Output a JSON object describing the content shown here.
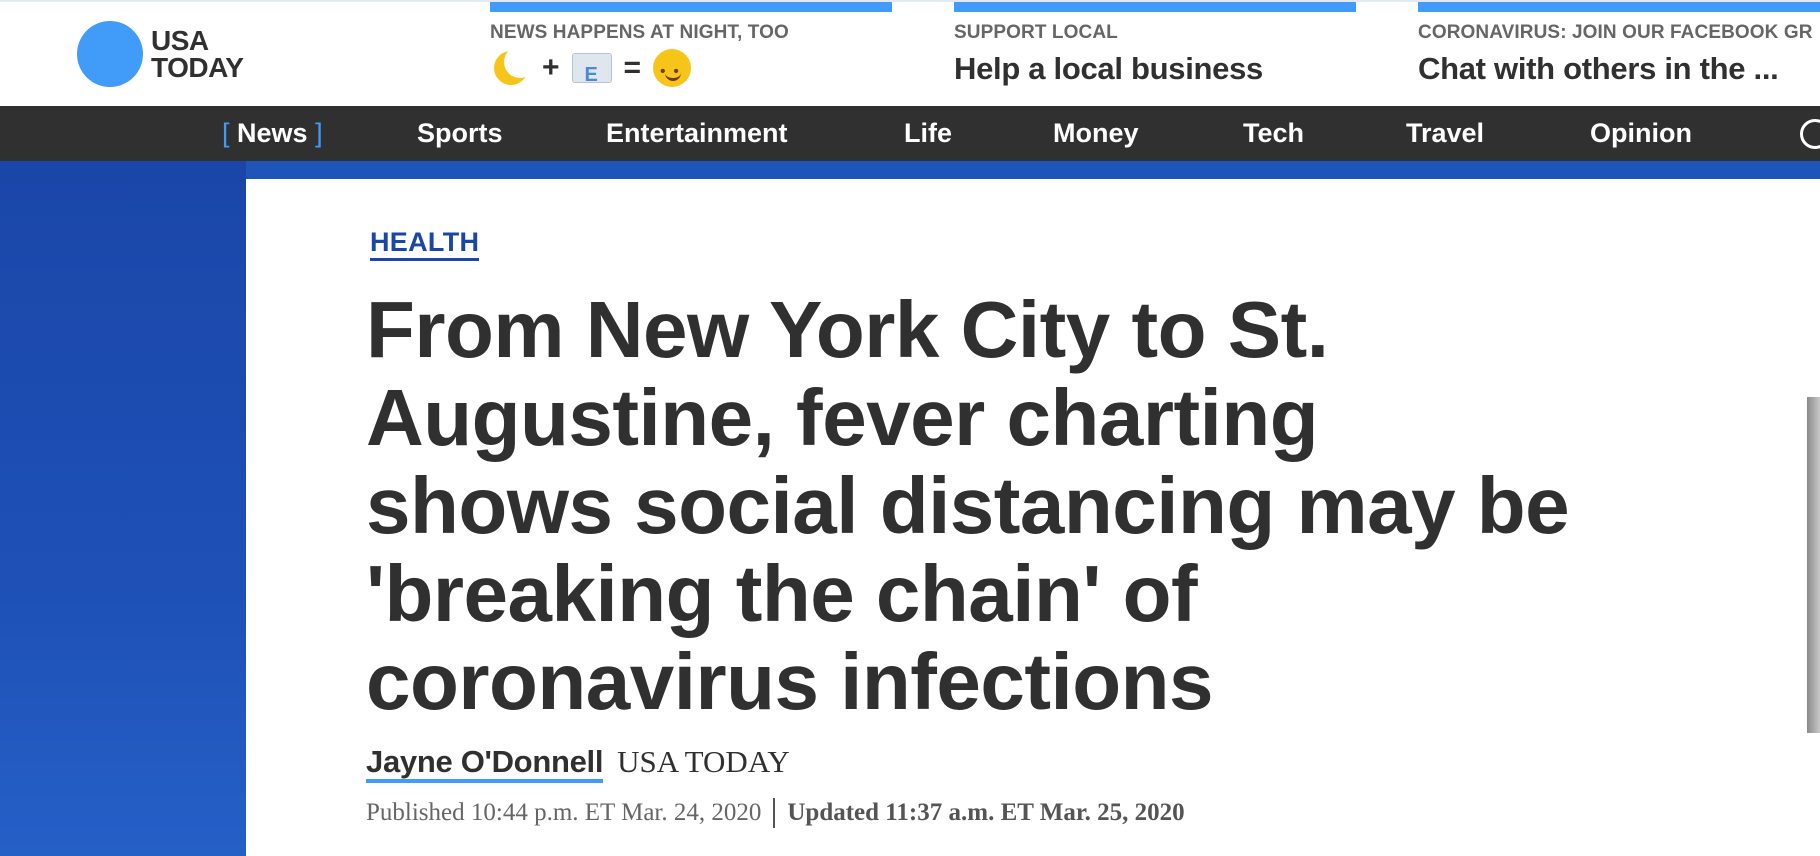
{
  "logo": {
    "line1": "USA",
    "line2": "TODAY"
  },
  "promos": [
    {
      "kicker": "NEWS HAPPENS AT NIGHT, TOO",
      "title": "",
      "emoji": [
        "moon-icon",
        "+",
        "envelope-icon",
        "=",
        "smirk-icon"
      ],
      "plus": "+",
      "equals": "="
    },
    {
      "kicker": "SUPPORT LOCAL",
      "title": "Help a local business"
    },
    {
      "kicker": "CORONAVIRUS: JOIN OUR FACEBOOK GR",
      "title": "Chat with others in the ..."
    }
  ],
  "nav": {
    "items": [
      "News",
      "Sports",
      "Entertainment",
      "Life",
      "Money",
      "Tech",
      "Travel",
      "Opinion"
    ],
    "active_open": "[",
    "active_close": "]"
  },
  "article": {
    "section": "HEALTH",
    "headline_lines": [
      "From New York City to St.",
      "Augustine, fever charting",
      "shows social distancing may be",
      "'breaking the chain' of",
      "coronavirus infections"
    ],
    "author": "Jayne O'Donnell",
    "outlet": "USA TODAY",
    "published": "Published 10:44 p.m. ET Mar. 24, 2020",
    "updated": "Updated 11:37 a.m. ET Mar. 25, 2020"
  },
  "colors": {
    "brand_blue": "#419bf9",
    "nav_bg": "#303030",
    "section_blue": "#1a46a8"
  }
}
